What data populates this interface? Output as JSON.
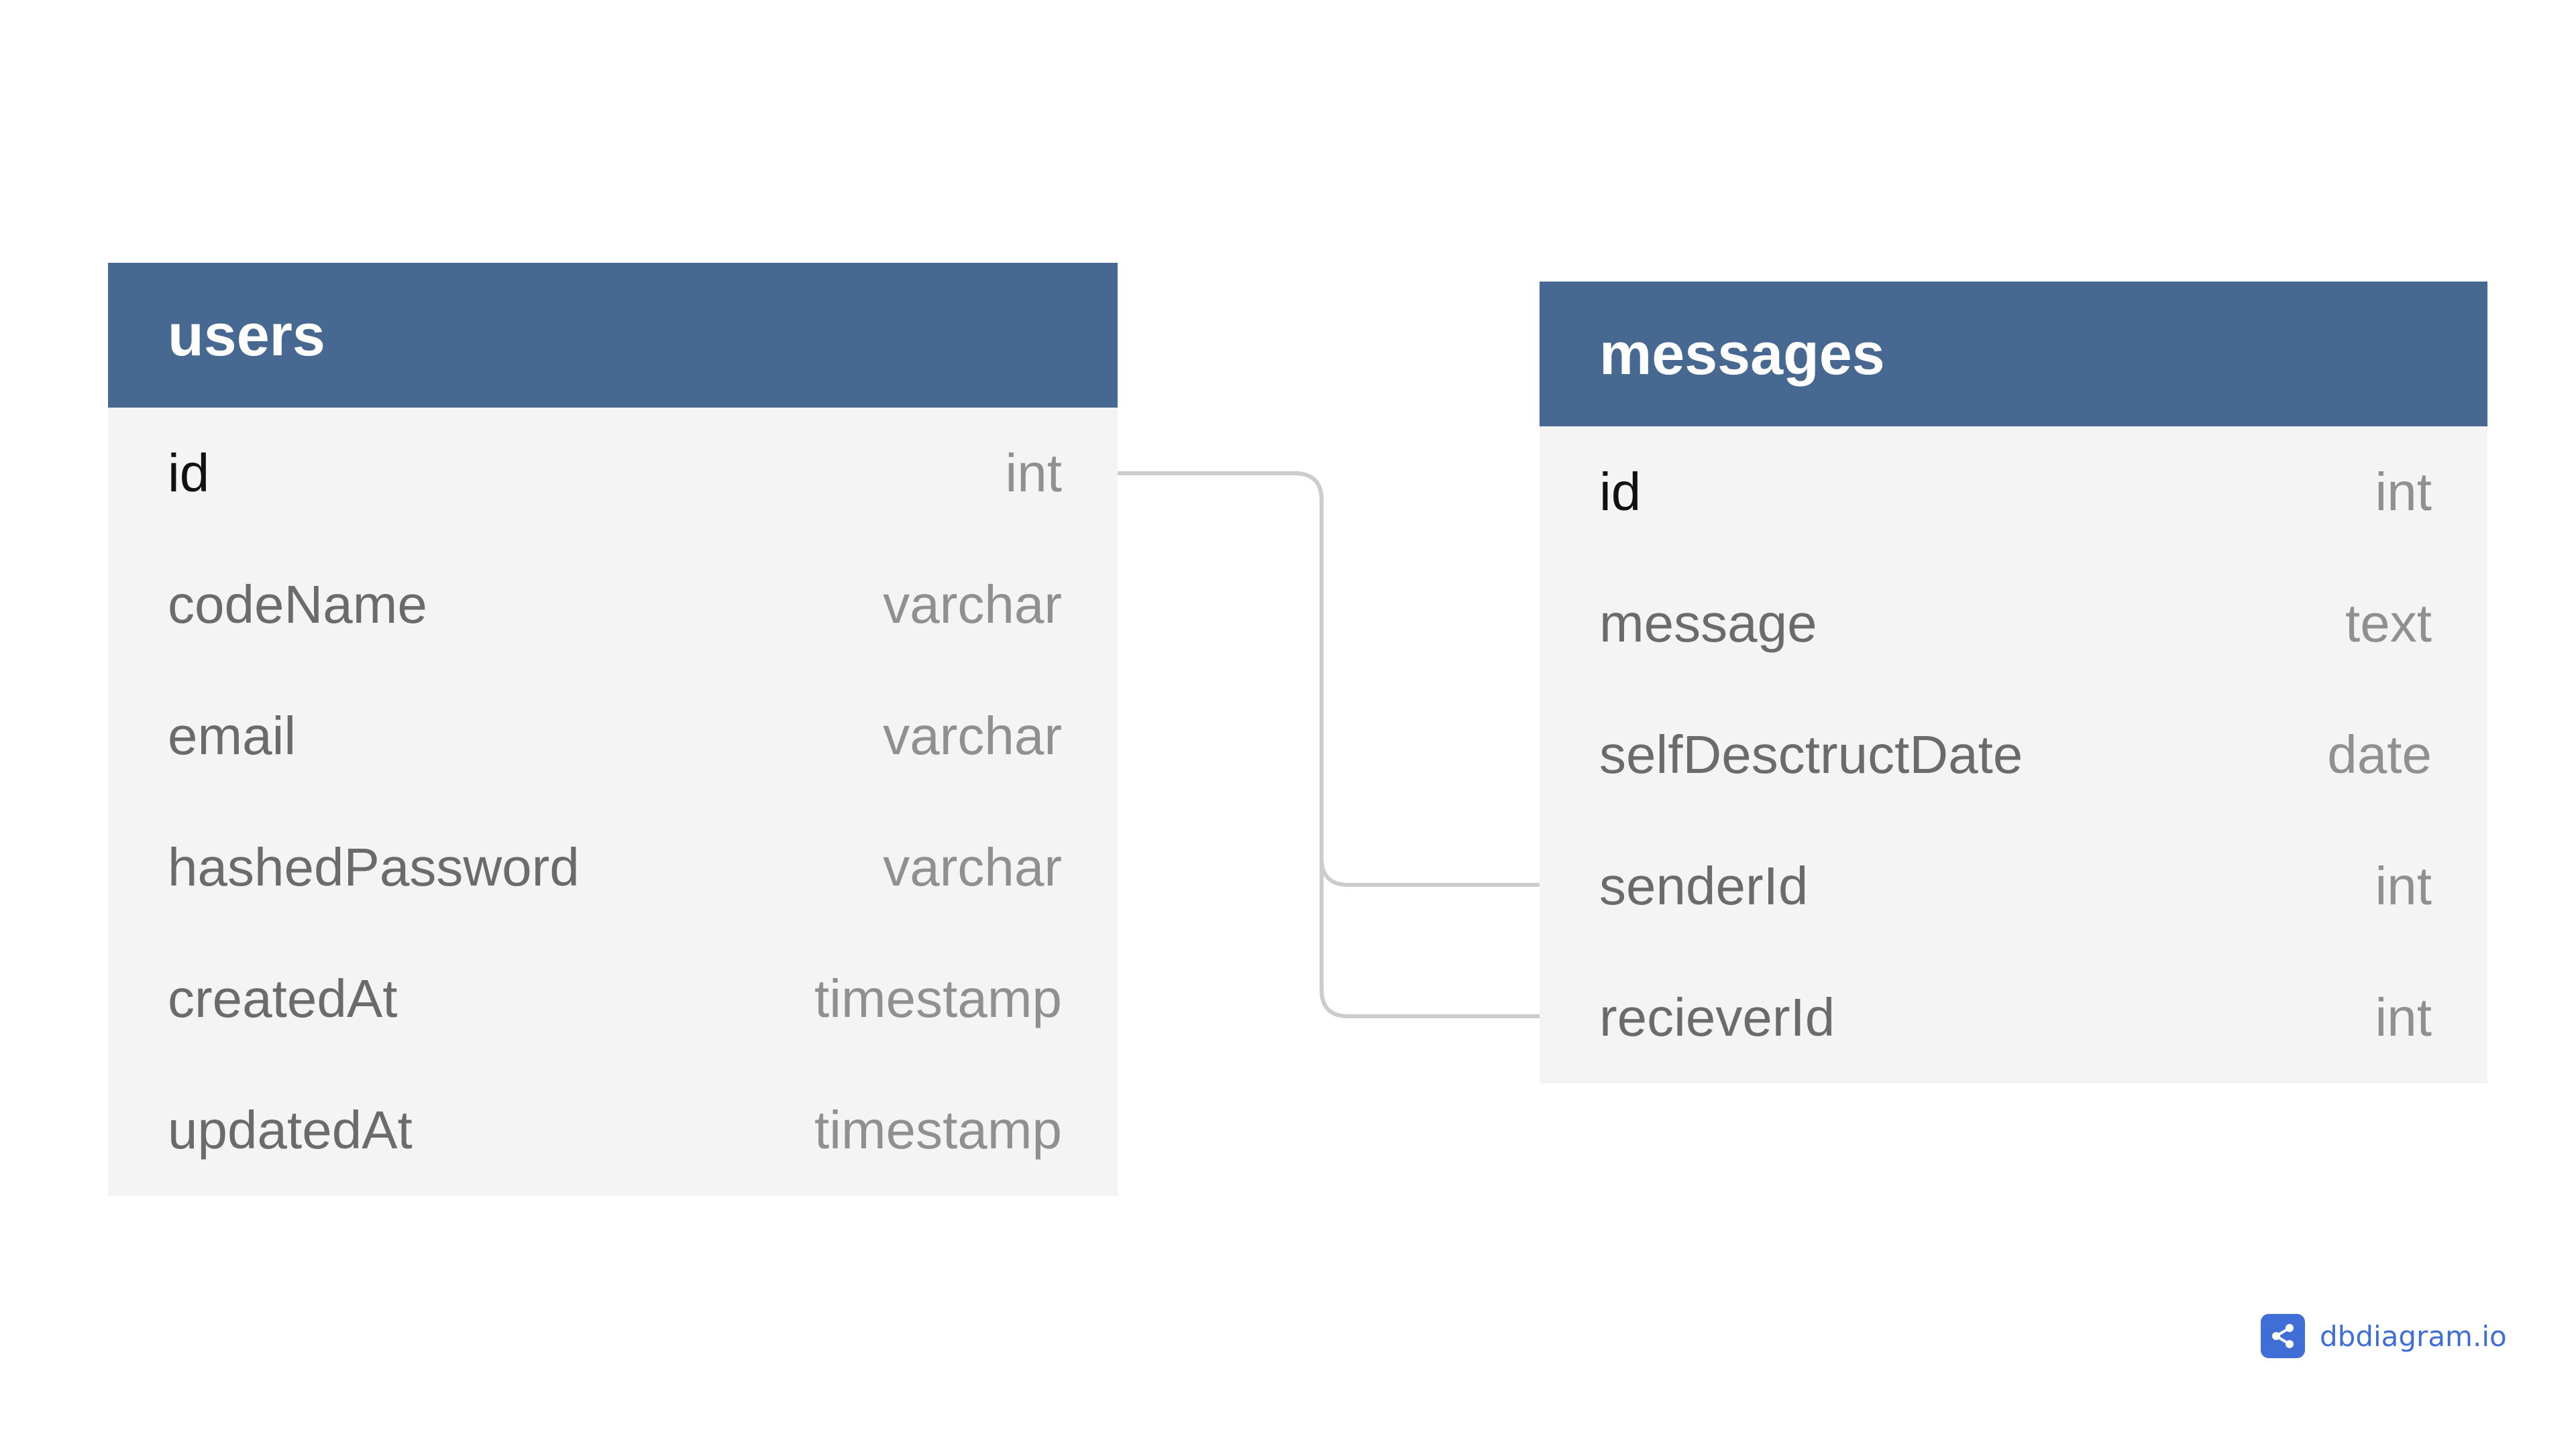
{
  "tables": [
    {
      "name": "users",
      "columns": [
        {
          "name": "id",
          "type": "int"
        },
        {
          "name": "codeName",
          "type": "varchar"
        },
        {
          "name": "email",
          "type": "varchar"
        },
        {
          "name": "hashedPassword",
          "type": "varchar"
        },
        {
          "name": "createdAt",
          "type": "timestamp"
        },
        {
          "name": "updatedAt",
          "type": "timestamp"
        }
      ]
    },
    {
      "name": "messages",
      "columns": [
        {
          "name": "id",
          "type": "int"
        },
        {
          "name": "message",
          "type": "text"
        },
        {
          "name": "selfDesctructDate",
          "type": "date"
        },
        {
          "name": "senderId",
          "type": "int"
        },
        {
          "name": "recieverId",
          "type": "int"
        }
      ]
    }
  ],
  "relations": [
    {
      "from": "users.id",
      "to": "messages.senderId"
    },
    {
      "from": "users.id",
      "to": "messages.recieverId"
    }
  ],
  "brand": {
    "name": "dbdiagram.io",
    "icon": "share-nodes-icon"
  },
  "colors": {
    "header": "#476891",
    "body": "#f4f4f4",
    "connector": "#cccccc",
    "brand": "#3f6fd6"
  }
}
